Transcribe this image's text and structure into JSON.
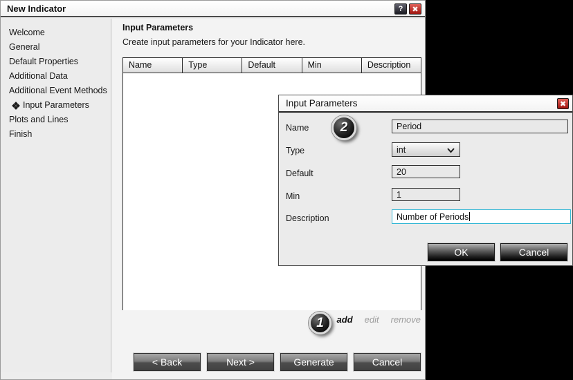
{
  "window": {
    "title": "New Indicator",
    "help_label": "?",
    "close_label": "✖"
  },
  "sidebar": {
    "items": [
      {
        "label": "Welcome",
        "active": false
      },
      {
        "label": "General",
        "active": false
      },
      {
        "label": "Default Properties",
        "active": false
      },
      {
        "label": "Additional Data",
        "active": false
      },
      {
        "label": "Additional Event Methods",
        "active": false
      },
      {
        "label": "Input Parameters",
        "active": true,
        "icon": "quad-diamond"
      },
      {
        "label": "Plots and Lines",
        "active": false
      },
      {
        "label": "Finish",
        "active": false
      }
    ]
  },
  "main": {
    "heading": "Input Parameters",
    "description": "Create input parameters for your Indicator here.",
    "table": {
      "columns": [
        "Name",
        "Type",
        "Default",
        "Min",
        "Description"
      ],
      "rows": []
    },
    "links": {
      "add": "add",
      "edit": "edit",
      "remove": "remove"
    },
    "buttons": {
      "back": "< Back",
      "next": "Next >",
      "generate": "Generate",
      "cancel": "Cancel"
    }
  },
  "dialog": {
    "title": "Input Parameters",
    "close_label": "✖",
    "fields": {
      "name": {
        "label": "Name",
        "value": "Period"
      },
      "type": {
        "label": "Type",
        "value": "int"
      },
      "default": {
        "label": "Default",
        "value": "20"
      },
      "min": {
        "label": "Min",
        "value": "1"
      },
      "description": {
        "label": "Description",
        "value": "Number of Periods",
        "focused": true
      }
    },
    "buttons": {
      "ok": "OK",
      "cancel": "Cancel"
    }
  },
  "callouts": {
    "step1": "1",
    "step2": "2"
  },
  "colors": {
    "focused_input_border": "#35b8d6",
    "close_button_red": "#a01510",
    "background": "#000000",
    "window_gray": "#ededed"
  }
}
